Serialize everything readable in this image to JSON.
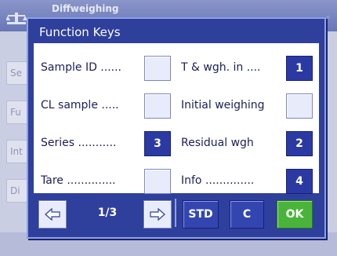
{
  "background": {
    "title": "Diffweighing",
    "items": [
      "Se",
      "Fu",
      "Int",
      "Di"
    ]
  },
  "dialog": {
    "title": "Function Keys",
    "left_column": [
      {
        "label": "Sample ID ......",
        "key": "",
        "active": false
      },
      {
        "label": "CL sample .....",
        "key": "",
        "active": false
      },
      {
        "label": "Series ...........",
        "key": "3",
        "active": true
      },
      {
        "label": "Tare ..............",
        "key": "",
        "active": false
      }
    ],
    "right_column": [
      {
        "label": "T & wgh. in ....",
        "key": "1",
        "active": true
      },
      {
        "label": "Initial weighing",
        "key": "",
        "active": false
      },
      {
        "label": "Residual wgh",
        "key": "2",
        "active": true
      },
      {
        "label": "Info ..............",
        "key": "4",
        "active": true
      }
    ],
    "footer": {
      "page_indicator": "1/3",
      "prev_icon": "arrow-left-icon",
      "next_icon": "arrow-right-icon",
      "std_label": "STD",
      "c_label": "C",
      "ok_label": "OK"
    },
    "colors": {
      "dialog_bg": "#2f3f9c",
      "active_key": "#2b3aa3",
      "ok_green": "#4ab43a"
    }
  }
}
